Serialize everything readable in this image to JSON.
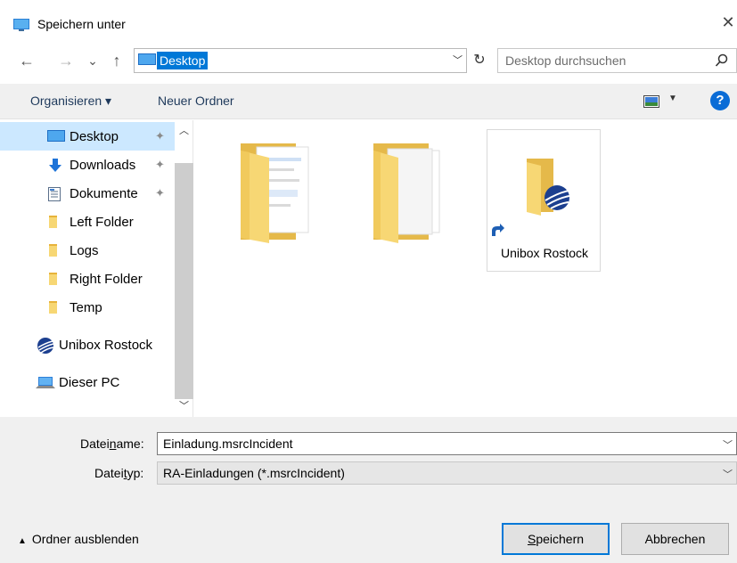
{
  "window": {
    "title": "Speichern unter",
    "close_glyph": "✕"
  },
  "nav": {
    "back_glyph": "←",
    "forward_glyph": "→",
    "recent_glyph": "⌄",
    "up_glyph": "↑",
    "address": "Desktop",
    "refresh_glyph": "↻",
    "search_placeholder": "Desktop durchsuchen"
  },
  "toolbar": {
    "organize": "Organisieren ▾",
    "new_folder": "Neuer Ordner",
    "help": "?"
  },
  "sidebar": {
    "items": [
      {
        "label": "Desktop",
        "icon": "desktop-icon",
        "pinned": true,
        "selected": true
      },
      {
        "label": "Downloads",
        "icon": "download-icon",
        "pinned": true
      },
      {
        "label": "Dokumente",
        "icon": "document-icon",
        "pinned": true
      },
      {
        "label": "Left Folder",
        "icon": "folder-icon"
      },
      {
        "label": "Logs",
        "icon": "folder-icon"
      },
      {
        "label": "Right Folder",
        "icon": "folder-icon"
      },
      {
        "label": "Temp",
        "icon": "folder-icon"
      },
      {
        "label": "Unibox Rostock",
        "icon": "unibox-icon"
      },
      {
        "label": "Dieser PC",
        "icon": "pc-icon"
      }
    ],
    "pin_glyph": "📌"
  },
  "content": {
    "items": [
      {
        "label": "",
        "icon": "folder-with-documents-icon"
      },
      {
        "label": "",
        "icon": "folder-with-pages-icon"
      },
      {
        "label": "Unibox Rostock",
        "icon": "unibox-shortcut-icon"
      }
    ]
  },
  "form": {
    "filename_label_pre": "Datei",
    "filename_label_u": "n",
    "filename_label_post": "ame:",
    "filename_value": "Einladung.msrcIncident",
    "filetype_label_pre": "Datei",
    "filetype_label_u": "t",
    "filetype_label_post": "yp:",
    "filetype_value": "RA-Einladungen (*.msrcIncident)",
    "hide_folders": "Ordner ausblenden",
    "save_u": "S",
    "save_rest": "peichern",
    "cancel": "Abbrechen"
  },
  "colors": {
    "accent": "#0078d7",
    "selection": "#cce8ff",
    "folder": "#f7d774"
  }
}
